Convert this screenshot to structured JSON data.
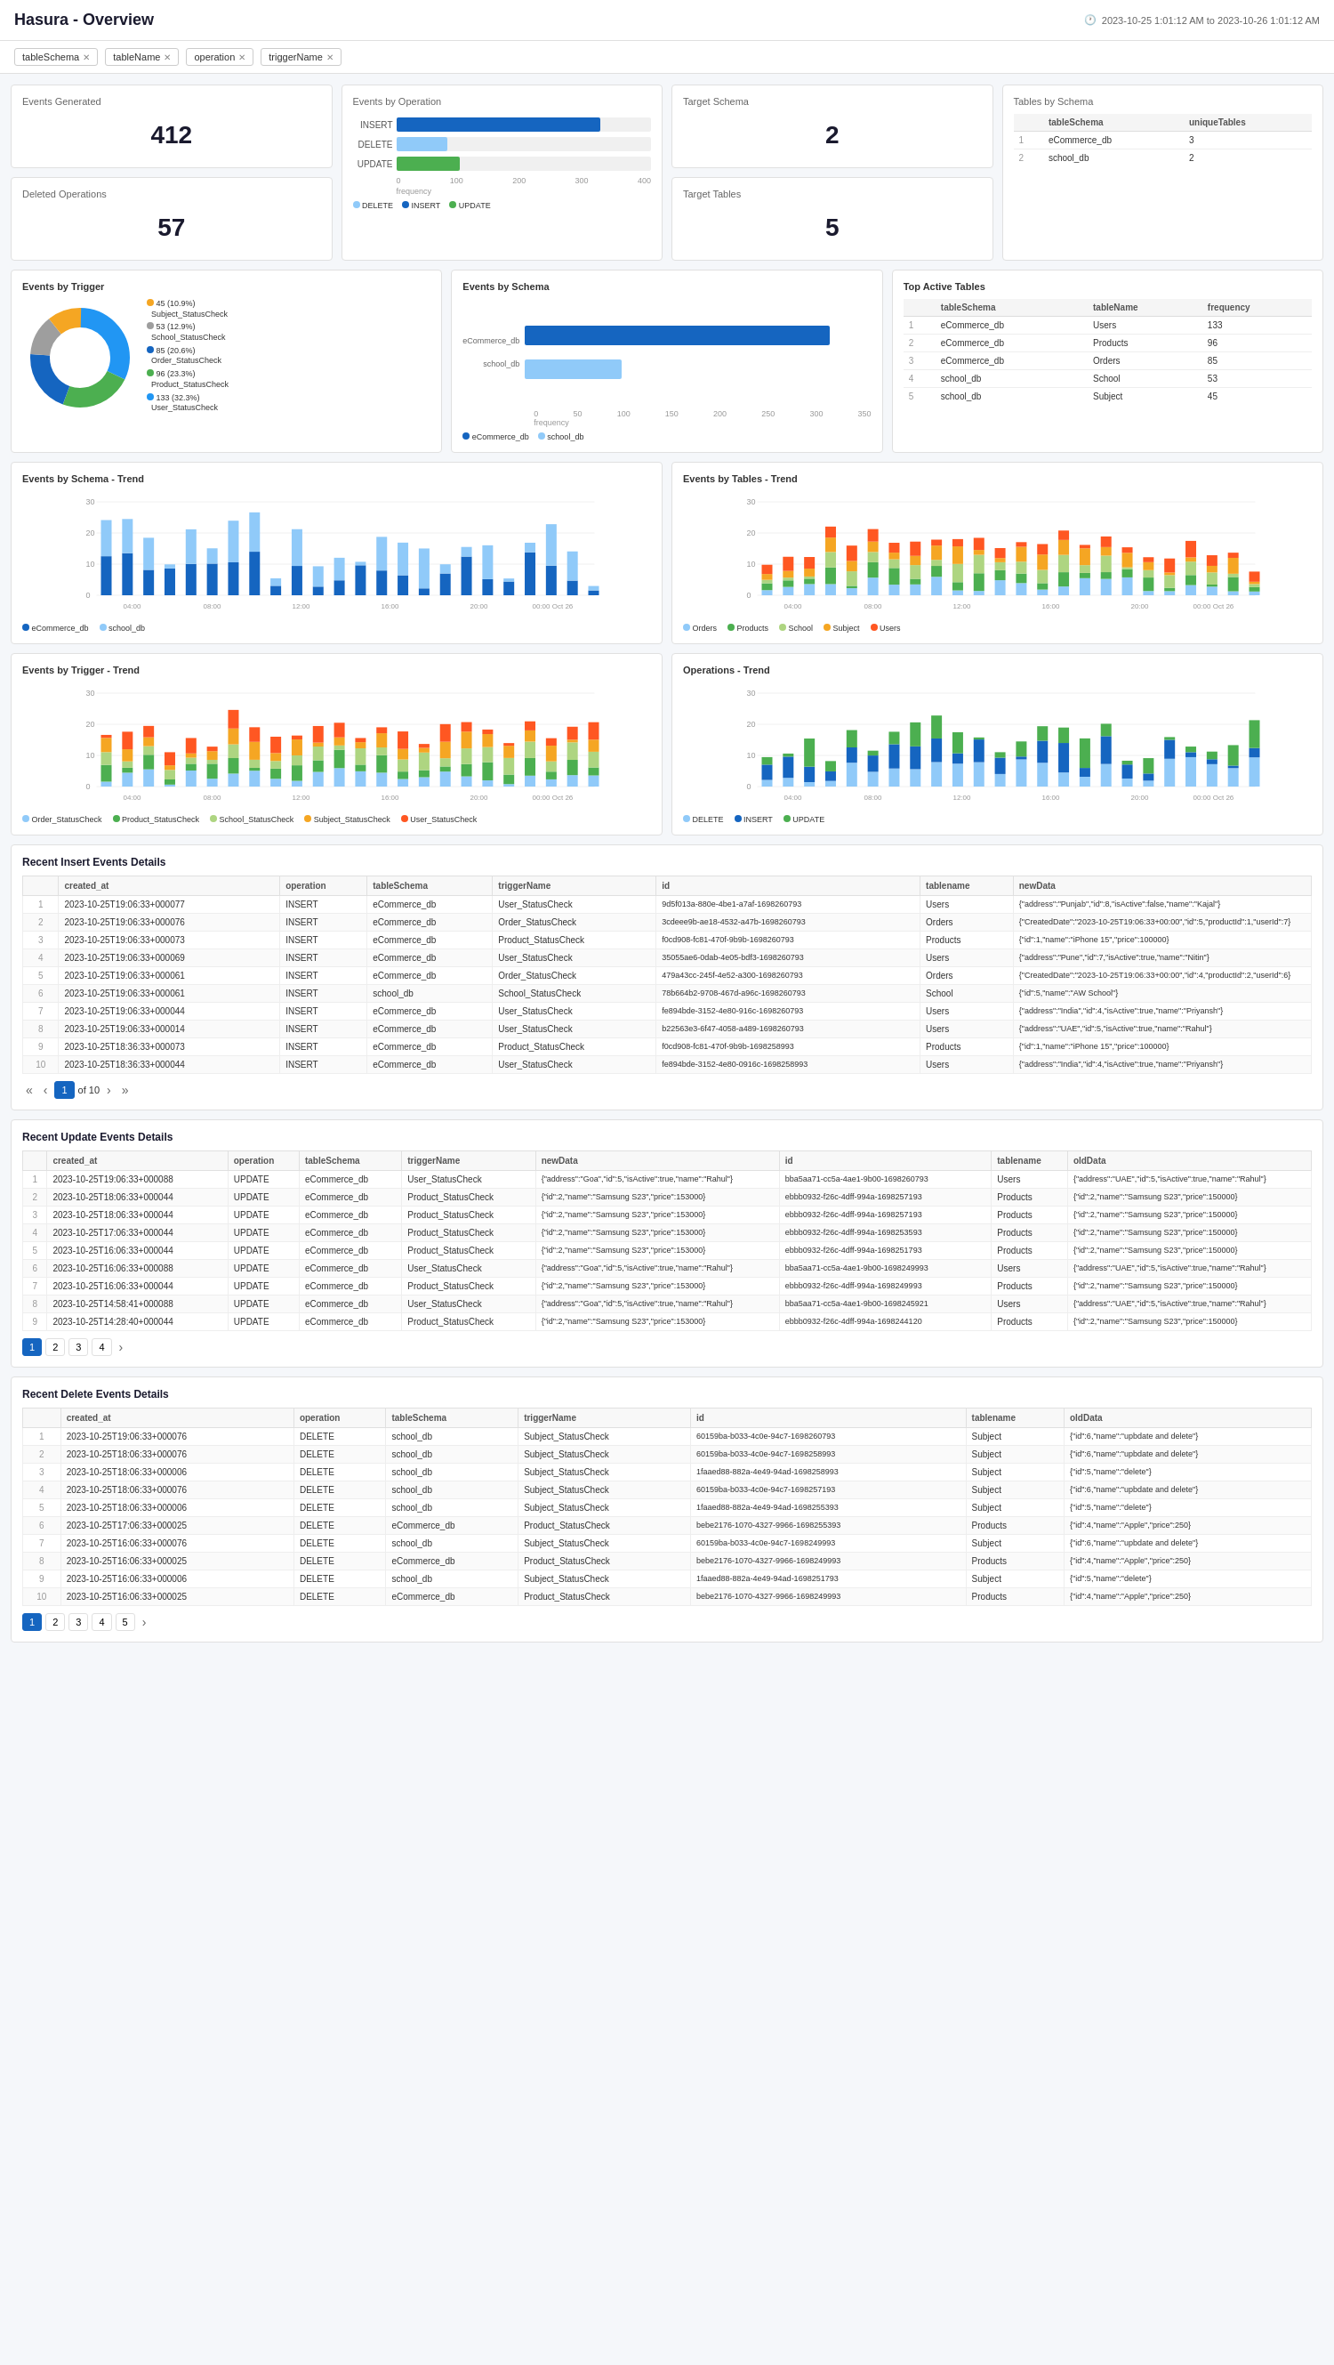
{
  "header": {
    "title": "Hasura - Overview",
    "timeRange": "2023-10-25 1:01:12 AM to 2023-10-26 1:01:12 AM"
  },
  "filters": [
    {
      "label": "tableSchema",
      "value": "*"
    },
    {
      "label": "tableName",
      "value": "*"
    },
    {
      "label": "operation",
      "value": "*"
    },
    {
      "label": "triggerName",
      "value": "*"
    }
  ],
  "stats": {
    "eventsGenerated": {
      "label": "Events Generated",
      "value": "412"
    },
    "deletedOperations": {
      "label": "Deleted Operations",
      "value": "57"
    },
    "targetSchema": {
      "label": "Target Schema",
      "value": "2"
    },
    "targetTables": {
      "label": "Target Tables",
      "value": "5"
    }
  },
  "eventsByOperation": {
    "title": "Events by Operation",
    "bars": [
      {
        "label": "INSERT",
        "pct": 80,
        "class": "insert"
      },
      {
        "label": "DELETE",
        "pct": 20,
        "class": "delete"
      },
      {
        "label": "UPDATE",
        "pct": 25,
        "class": "update"
      }
    ],
    "axis": [
      "0",
      "100",
      "200",
      "300",
      "400"
    ],
    "legend": [
      {
        "label": "DELETE",
        "class": "delete"
      },
      {
        "label": "INSERT",
        "class": "insert"
      },
      {
        "label": "UPDATE",
        "class": "update"
      }
    ]
  },
  "tablesBySchema": {
    "title": "Tables by Schema",
    "headers": [
      "tableSchema",
      "uniqueTables"
    ],
    "rows": [
      {
        "num": 1,
        "schema": "eCommerce_db",
        "tables": "3"
      },
      {
        "num": 2,
        "schema": "school_db",
        "tables": "2"
      }
    ]
  },
  "eventsByTrigger": {
    "title": "Events by Trigger",
    "segments": [
      {
        "label": "45 (10.9%)\nSubject_StatusCheck",
        "color": "#f5a623",
        "pct": 10.9
      },
      {
        "label": "53 (12.9%)\nSchool_StatusCheck",
        "color": "#7b7b7b",
        "pct": 12.9
      },
      {
        "label": "85 (20.6%)\nOrder_StatusCheck",
        "color": "#1565c0",
        "pct": 20.6
      },
      {
        "label": "96 (23.3%)\nProduct_StatusCheck",
        "color": "#4caf50",
        "pct": 23.3
      },
      {
        "label": "133 (32.3%)\nUser_StatusCheck",
        "color": "#2196f3",
        "pct": 32.3
      }
    ]
  },
  "eventsBySchema": {
    "title": "Events by Schema",
    "bars": [
      {
        "label": "eCommerce_db",
        "pct": 90,
        "class": "ecommerce"
      },
      {
        "label": "school_db",
        "pct": 30,
        "class": "school"
      }
    ],
    "legend": [
      {
        "label": "eCommerce_db",
        "color": "#1565c0"
      },
      {
        "label": "school_db",
        "color": "#90caf9"
      }
    ]
  },
  "topActiveTables": {
    "title": "Top Active Tables",
    "headers": [
      "tableSchema",
      "tableName",
      "frequency"
    ],
    "rows": [
      {
        "num": 1,
        "schema": "eCommerce_db",
        "table": "Users",
        "freq": "133"
      },
      {
        "num": 2,
        "schema": "eCommerce_db",
        "table": "Products",
        "freq": "96"
      },
      {
        "num": 3,
        "schema": "eCommerce_db",
        "table": "Orders",
        "freq": "85"
      },
      {
        "num": 4,
        "schema": "school_db",
        "table": "School",
        "freq": "53"
      },
      {
        "num": 5,
        "schema": "school_db",
        "table": "Subject",
        "freq": "45"
      }
    ]
  },
  "trendSchemaTitle": "Events by Schema - Trend",
  "trendTablesTitle": "Events by Tables - Trend",
  "trendTriggerTitle": "Events by Trigger - Trend",
  "trendOperationsTitle": "Operations - Trend",
  "trendSchemeLegend": [
    {
      "label": "eCommerce_db",
      "color": "#1565c0"
    },
    {
      "label": "school_db",
      "color": "#90caf9"
    }
  ],
  "trendTablesLegend": [
    {
      "label": "Orders",
      "color": "#90caf9"
    },
    {
      "label": "Products",
      "color": "#4caf50"
    },
    {
      "label": "School",
      "color": "#aed581"
    },
    {
      "label": "Subject",
      "color": "#f5a623"
    },
    {
      "label": "Users",
      "color": "#ff5722"
    }
  ],
  "trendTriggerLegend": [
    {
      "label": "Order_StatusCheck",
      "color": "#90caf9"
    },
    {
      "label": "Product_StatusCheck",
      "color": "#4caf50"
    },
    {
      "label": "School_StatusCheck",
      "color": "#aed581"
    },
    {
      "label": "Subject_StatusCheck",
      "color": "#f5a623"
    },
    {
      "label": "User_StatusCheck",
      "color": "#ff5722"
    }
  ],
  "trendOperationsLegend": [
    {
      "label": "DELETE",
      "color": "#90caf9"
    },
    {
      "label": "INSERT",
      "color": "#1565c0"
    },
    {
      "label": "UPDATE",
      "color": "#4caf50"
    }
  ],
  "recentInsert": {
    "title": "Recent Insert Events Details",
    "headers": [
      "",
      "created_at",
      "operation",
      "tableSchema",
      "triggerName",
      "id",
      "tablename",
      "newData"
    ],
    "rows": [
      {
        "num": 1,
        "created_at": "2023-10-25T19:06:33+000077",
        "operation": "INSERT",
        "tableSchema": "eCommerce_db",
        "triggerName": "User_StatusCheck",
        "id": "9d5f013a-880e-4be1-a7af-1698260793",
        "tablename": "Users",
        "newData": "{\"address\":\"Punjab\",\"id\":8,\"isActive\":false,\"name\":\"Kajal\"}"
      },
      {
        "num": 2,
        "created_at": "2023-10-25T19:06:33+000076",
        "operation": "INSERT",
        "tableSchema": "eCommerce_db",
        "triggerName": "Order_StatusCheck",
        "id": "3cdeee9b-ae18-4532-a47b-1698260793",
        "tablename": "Orders",
        "newData": "{\"CreatedDate\":\"2023-10-25T19:06:33+00:00\",\"id\":5,\"productId\":1,\"userId\":7}"
      },
      {
        "num": 3,
        "created_at": "2023-10-25T19:06:33+000073",
        "operation": "INSERT",
        "tableSchema": "eCommerce_db",
        "triggerName": "Product_StatusCheck",
        "id": "f0cd908-fc81-470f-9b9b-1698260793",
        "tablename": "Products",
        "newData": "{\"id\":1,\"name\":\"iPhone 15\",\"price\":100000}"
      },
      {
        "num": 4,
        "created_at": "2023-10-25T19:06:33+000069",
        "operation": "INSERT",
        "tableSchema": "eCommerce_db",
        "triggerName": "User_StatusCheck",
        "id": "35055ae6-0dab-4e05-bdf3-1698260793",
        "tablename": "Users",
        "newData": "{\"address\":\"Pune\",\"id\":7,\"isActive\":true,\"name\":\"Nitin\"}"
      },
      {
        "num": 5,
        "created_at": "2023-10-25T19:06:33+000061",
        "operation": "INSERT",
        "tableSchema": "eCommerce_db",
        "triggerName": "Order_StatusCheck",
        "id": "479a43cc-245f-4e52-a300-1698260793",
        "tablename": "Orders",
        "newData": "{\"CreatedDate\":\"2023-10-25T19:06:33+00:00\",\"id\":4,\"productId\":2,\"userId\":6}"
      },
      {
        "num": 6,
        "created_at": "2023-10-25T19:06:33+000061",
        "operation": "INSERT",
        "tableSchema": "school_db",
        "triggerName": "School_StatusCheck",
        "id": "78b664b2-9708-467d-a96c-1698260793",
        "tablename": "School",
        "newData": "{\"id\":5,\"name\":\"AW School\"}"
      },
      {
        "num": 7,
        "created_at": "2023-10-25T19:06:33+000044",
        "operation": "INSERT",
        "tableSchema": "eCommerce_db",
        "triggerName": "User_StatusCheck",
        "id": "fe894bde-3152-4e80-916c-1698260793",
        "tablename": "Users",
        "newData": "{\"address\":\"India\",\"id\":4,\"isActive\":true,\"name\":\"Priyansh\"}"
      },
      {
        "num": 8,
        "created_at": "2023-10-25T19:06:33+000014",
        "operation": "INSERT",
        "tableSchema": "eCommerce_db",
        "triggerName": "User_StatusCheck",
        "id": "b22563e3-6f47-4058-a489-1698260793",
        "tablename": "Users",
        "newData": "{\"address\":\"UAE\",\"id\":5,\"isActive\":true,\"name\":\"Rahul\"}"
      },
      {
        "num": 9,
        "created_at": "2023-10-25T18:36:33+000073",
        "operation": "INSERT",
        "tableSchema": "eCommerce_db",
        "triggerName": "Product_StatusCheck",
        "id": "f0cd908-fc81-470f-9b9b-1698258993",
        "tablename": "Products",
        "newData": "{\"id\":1,\"name\":\"iPhone 15\",\"price\":100000}"
      },
      {
        "num": 10,
        "created_at": "2023-10-25T18:36:33+000044",
        "operation": "INSERT",
        "tableSchema": "eCommerce_db",
        "triggerName": "User_StatusCheck",
        "id": "fe894bde-3152-4e80-0916c-1698258993",
        "tablename": "Users",
        "newData": "{\"address\":\"India\",\"id\":4,\"isActive\":true,\"name\":\"Priyansh\"}"
      }
    ],
    "pagination": {
      "current": 1,
      "total": 10
    }
  },
  "recentUpdate": {
    "title": "Recent Update Events Details",
    "headers": [
      "",
      "created_at",
      "operation",
      "tableSchema",
      "triggerName",
      "newData",
      "id",
      "tablename",
      "oldData"
    ],
    "rows": [
      {
        "num": 1,
        "created_at": "2023-10-25T19:06:33+000088",
        "operation": "UPDATE",
        "tableSchema": "eCommerce_db",
        "triggerName": "User_StatusCheck",
        "newData": "{\"address\":\"Goa\",\"id\":5,\"isActive\":true,\"name\":\"Rahul\"}",
        "id": "bba5aa71-cc5a-4ae1-9b00-1698260793",
        "tablename": "Users",
        "oldData": "{\"address\":\"UAE\",\"id\":5,\"isActive\":true,\"name\":\"Rahul\"}"
      },
      {
        "num": 2,
        "created_at": "2023-10-25T18:06:33+000044",
        "operation": "UPDATE",
        "tableSchema": "eCommerce_db",
        "triggerName": "Product_StatusCheck",
        "newData": "{\"id\":2,\"name\":\"Samsung S23\",\"price\":153000}",
        "id": "ebbb0932-f26c-4dff-994a-1698257193",
        "tablename": "Products",
        "oldData": "{\"id\":2,\"name\":\"Samsung S23\",\"price\":150000}"
      },
      {
        "num": 3,
        "created_at": "2023-10-25T18:06:33+000044",
        "operation": "UPDATE",
        "tableSchema": "eCommerce_db",
        "triggerName": "Product_StatusCheck",
        "newData": "{\"id\":2,\"name\":\"Samsung S23\",\"price\":153000}",
        "id": "ebbb0932-f26c-4dff-994a-1698257193",
        "tablename": "Products",
        "oldData": "{\"id\":2,\"name\":\"Samsung S23\",\"price\":150000}"
      },
      {
        "num": 4,
        "created_at": "2023-10-25T17:06:33+000044",
        "operation": "UPDATE",
        "tableSchema": "eCommerce_db",
        "triggerName": "Product_StatusCheck",
        "newData": "{\"id\":2,\"name\":\"Samsung S23\",\"price\":153000}",
        "id": "ebbb0932-f26c-4dff-994a-1698253593",
        "tablename": "Products",
        "oldData": "{\"id\":2,\"name\":\"Samsung S23\",\"price\":150000}"
      },
      {
        "num": 5,
        "created_at": "2023-10-25T16:06:33+000044",
        "operation": "UPDATE",
        "tableSchema": "eCommerce_db",
        "triggerName": "Product_StatusCheck",
        "newData": "{\"id\":2,\"name\":\"Samsung S23\",\"price\":153000}",
        "id": "ebbb0932-f26c-4dff-994a-1698251793",
        "tablename": "Products",
        "oldData": "{\"id\":2,\"name\":\"Samsung S23\",\"price\":150000}"
      },
      {
        "num": 6,
        "created_at": "2023-10-25T16:06:33+000088",
        "operation": "UPDATE",
        "tableSchema": "eCommerce_db",
        "triggerName": "User_StatusCheck",
        "newData": "{\"address\":\"Goa\",\"id\":5,\"isActive\":true,\"name\":\"Rahul\"}",
        "id": "bba5aa71-cc5a-4ae1-9b00-1698249993",
        "tablename": "Users",
        "oldData": "{\"address\":\"UAE\",\"id\":5,\"isActive\":true,\"name\":\"Rahul\"}"
      },
      {
        "num": 7,
        "created_at": "2023-10-25T16:06:33+000044",
        "operation": "UPDATE",
        "tableSchema": "eCommerce_db",
        "triggerName": "Product_StatusCheck",
        "newData": "{\"id\":2,\"name\":\"Samsung S23\",\"price\":153000}",
        "id": "ebbb0932-f26c-4dff-994a-1698249993",
        "tablename": "Products",
        "oldData": "{\"id\":2,\"name\":\"Samsung S23\",\"price\":150000}"
      },
      {
        "num": 8,
        "created_at": "2023-10-25T14:58:41+000088",
        "operation": "UPDATE",
        "tableSchema": "eCommerce_db",
        "triggerName": "User_StatusCheck",
        "newData": "{\"address\":\"Goa\",\"id\":5,\"isActive\":true,\"name\":\"Rahul\"}",
        "id": "bba5aa71-cc5a-4ae1-9b00-1698245921",
        "tablename": "Users",
        "oldData": "{\"address\":\"UAE\",\"id\":5,\"isActive\":true,\"name\":\"Rahul\"}"
      },
      {
        "num": 9,
        "created_at": "2023-10-25T14:28:40+000044",
        "operation": "UPDATE",
        "tableSchema": "eCommerce_db",
        "triggerName": "Product_StatusCheck",
        "newData": "{\"id\":2,\"name\":\"Samsung S23\",\"price\":153000}",
        "id": "ebbb0932-f26c-4dff-994a-1698244120",
        "tablename": "Products",
        "oldData": "{\"id\":2,\"name\":\"Samsung S23\",\"price\":150000}"
      }
    ],
    "pagination": {
      "pages": [
        1,
        2,
        3,
        4
      ]
    }
  },
  "recentDelete": {
    "title": "Recent Delete Events Details",
    "headers": [
      "",
      "created_at",
      "operation",
      "tableSchema",
      "triggerName",
      "id",
      "tablename",
      "oldData"
    ],
    "rows": [
      {
        "num": 1,
        "created_at": "2023-10-25T19:06:33+000076",
        "operation": "DELETE",
        "tableSchema": "school_db",
        "triggerName": "Subject_StatusCheck",
        "id": "60159ba-b033-4c0e-94c7-1698260793",
        "tablename": "Subject",
        "oldData": "{\"id\":6,\"name\":\"upbdate and delete\"}"
      },
      {
        "num": 2,
        "created_at": "2023-10-25T18:06:33+000076",
        "operation": "DELETE",
        "tableSchema": "school_db",
        "triggerName": "Subject_StatusCheck",
        "id": "60159ba-b033-4c0e-94c7-1698258993",
        "tablename": "Subject",
        "oldData": "{\"id\":6,\"name\":\"upbdate and delete\"}"
      },
      {
        "num": 3,
        "created_at": "2023-10-25T18:06:33+000006",
        "operation": "DELETE",
        "tableSchema": "school_db",
        "triggerName": "Subject_StatusCheck",
        "id": "1faaed88-882a-4e49-94ad-1698258993",
        "tablename": "Subject",
        "oldData": "{\"id\":5,\"name\":\"delete\"}"
      },
      {
        "num": 4,
        "created_at": "2023-10-25T18:06:33+000076",
        "operation": "DELETE",
        "tableSchema": "school_db",
        "triggerName": "Subject_StatusCheck",
        "id": "60159ba-b033-4c0e-94c7-1698257193",
        "tablename": "Subject",
        "oldData": "{\"id\":6,\"name\":\"upbdate and delete\"}"
      },
      {
        "num": 5,
        "created_at": "2023-10-25T18:06:33+000006",
        "operation": "DELETE",
        "tableSchema": "school_db",
        "triggerName": "Subject_StatusCheck",
        "id": "1faaed88-882a-4e49-94ad-1698255393",
        "tablename": "Subject",
        "oldData": "{\"id\":5,\"name\":\"delete\"}"
      },
      {
        "num": 6,
        "created_at": "2023-10-25T17:06:33+000025",
        "operation": "DELETE",
        "tableSchema": "eCommerce_db",
        "triggerName": "Product_StatusCheck",
        "id": "bebe2176-1070-4327-9966-1698255393",
        "tablename": "Products",
        "oldData": "{\"id\":4,\"name\":\"Apple\",\"price\":250}"
      },
      {
        "num": 7,
        "created_at": "2023-10-25T16:06:33+000076",
        "operation": "DELETE",
        "tableSchema": "school_db",
        "triggerName": "Subject_StatusCheck",
        "id": "60159ba-b033-4c0e-94c7-1698249993",
        "tablename": "Subject",
        "oldData": "{\"id\":6,\"name\":\"upbdate and delete\"}"
      },
      {
        "num": 8,
        "created_at": "2023-10-25T16:06:33+000025",
        "operation": "DELETE",
        "tableSchema": "eCommerce_db",
        "triggerName": "Product_StatusCheck",
        "id": "bebe2176-1070-4327-9966-1698249993",
        "tablename": "Products",
        "oldData": "{\"id\":4,\"name\":\"Apple\",\"price\":250}"
      },
      {
        "num": 9,
        "created_at": "2023-10-25T16:06:33+000006",
        "operation": "DELETE",
        "tableSchema": "school_db",
        "triggerName": "Subject_StatusCheck",
        "id": "1faaed88-882a-4e49-94ad-1698251793",
        "tablename": "Subject",
        "oldData": "{\"id\":5,\"name\":\"delete\"}"
      },
      {
        "num": 10,
        "created_at": "2023-10-25T16:06:33+000025",
        "operation": "DELETE",
        "tableSchema": "eCommerce_db",
        "triggerName": "Product_StatusCheck",
        "id": "bebe2176-1070-4327-9966-1698249993",
        "tablename": "Products",
        "oldData": "{\"id\":4,\"name\":\"Apple\",\"price\":250}"
      }
    ],
    "pagination": {
      "pages": [
        1,
        2,
        3,
        4,
        5
      ]
    }
  }
}
